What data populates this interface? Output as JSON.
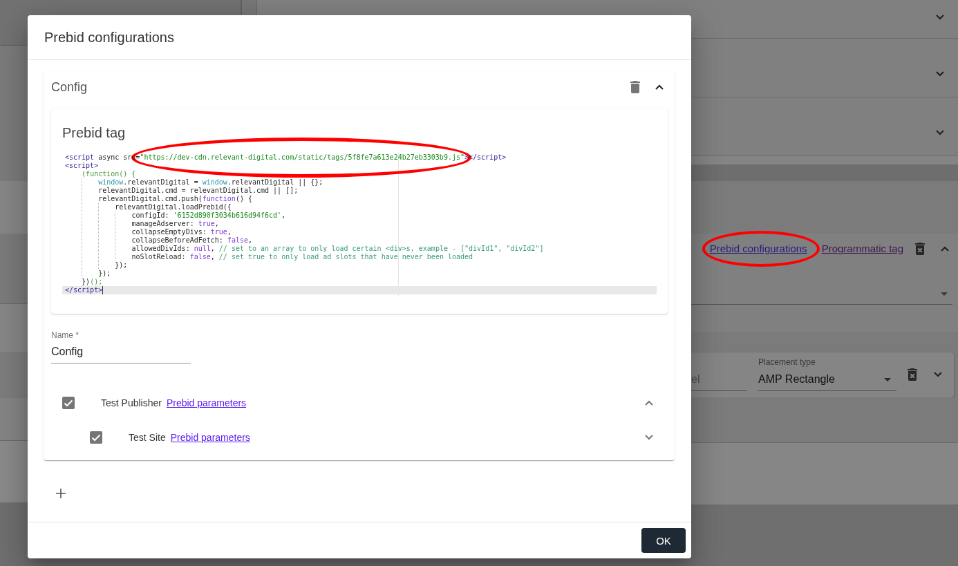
{
  "background": {
    "sections": [
      {
        "expanded": false
      },
      {
        "expanded": false
      },
      {
        "expanded": false
      }
    ],
    "ad_unit": {
      "links": [
        {
          "label": "Prebid configurations",
          "visited": false,
          "circled": true
        },
        {
          "label": "Programmatic tag",
          "visited": true,
          "circled": false
        }
      ],
      "expanded": true
    },
    "placement": {
      "name_field": {
        "placeholder": "el"
      },
      "type_field": {
        "label": "Placement type",
        "value": "AMP Rectangle"
      },
      "expanded": false
    }
  },
  "dialog": {
    "title": "Prebid configurations",
    "configs": [
      {
        "title": "Config",
        "expanded": true,
        "tag_card": {
          "title": "Prebid tag",
          "code_lines": [
            {
              "active": false,
              "segments": [
                {
                  "kind": "tag",
                  "text": "<script",
                  "circled": false
                },
                {
                  "kind": "plain",
                  "text": " async src=",
                  "circled": false
                },
                {
                  "kind": "string",
                  "text": "\"https://dev-cdn.relevant-digital.com/static/tags/5f8fe7a613e24b27eb3303b9.js\"",
                  "circled": true
                },
                {
                  "kind": "tag",
                  "text": "></script>",
                  "circled": false
                }
              ]
            },
            {
              "active": false,
              "segments": [
                {
                  "kind": "tag",
                  "text": "<script>",
                  "circled": false
                }
              ]
            },
            {
              "active": false,
              "segments": [
                {
                  "kind": "paren",
                  "text": "    (function() {",
                  "circled": false
                }
              ]
            },
            {
              "active": false,
              "segments": [
                {
                  "kind": "variable",
                  "text": "        window",
                  "circled": false
                },
                {
                  "kind": "plain",
                  "text": ".relevantDigital = ",
                  "circled": false
                },
                {
                  "kind": "variable",
                  "text": "window",
                  "circled": false
                },
                {
                  "kind": "plain",
                  "text": ".relevantDigital || {};",
                  "circled": false
                }
              ]
            },
            {
              "active": false,
              "segments": [
                {
                  "kind": "plain",
                  "text": "        relevantDigital.cmd = relevantDigital.cmd || [];",
                  "circled": false
                }
              ]
            },
            {
              "active": false,
              "segments": [
                {
                  "kind": "plain",
                  "text": "        relevantDigital.cmd.push(",
                  "circled": false
                },
                {
                  "kind": "keyword",
                  "text": "function",
                  "circled": false
                },
                {
                  "kind": "plain",
                  "text": "() {",
                  "circled": false
                }
              ]
            },
            {
              "active": false,
              "segments": [
                {
                  "kind": "plain",
                  "text": "            relevantDigital.loadPrebid({",
                  "circled": false
                }
              ]
            },
            {
              "active": false,
              "segments": [
                {
                  "kind": "plain",
                  "text": "                configId: ",
                  "circled": false
                },
                {
                  "kind": "string",
                  "text": "'6152d890f3034b616d94f6cd'",
                  "circled": false
                },
                {
                  "kind": "plain",
                  "text": ",",
                  "circled": false
                }
              ]
            },
            {
              "active": false,
              "segments": [
                {
                  "kind": "plain",
                  "text": "                manageAdserver: ",
                  "circled": false
                },
                {
                  "kind": "keyword",
                  "text": "true",
                  "circled": false
                },
                {
                  "kind": "plain",
                  "text": ",",
                  "circled": false
                }
              ]
            },
            {
              "active": false,
              "segments": [
                {
                  "kind": "plain",
                  "text": "                collapseEmptyDivs: ",
                  "circled": false
                },
                {
                  "kind": "keyword",
                  "text": "true",
                  "circled": false
                },
                {
                  "kind": "plain",
                  "text": ",",
                  "circled": false
                }
              ]
            },
            {
              "active": false,
              "segments": [
                {
                  "kind": "plain",
                  "text": "                collapseBeforeAdFetch: ",
                  "circled": false
                },
                {
                  "kind": "keyword",
                  "text": "false",
                  "circled": false
                },
                {
                  "kind": "plain",
                  "text": ",",
                  "circled": false
                }
              ]
            },
            {
              "active": false,
              "segments": [
                {
                  "kind": "plain",
                  "text": "                allowedDivIds: ",
                  "circled": false
                },
                {
                  "kind": "keyword",
                  "text": "null",
                  "circled": false
                },
                {
                  "kind": "plain",
                  "text": ", ",
                  "circled": false
                },
                {
                  "kind": "comment",
                  "text": "// set to an array to only load certain <div>s, example - [\"divId1\", \"divId2\"]",
                  "circled": false
                }
              ]
            },
            {
              "active": false,
              "segments": [
                {
                  "kind": "plain",
                  "text": "                noSlotReload: ",
                  "circled": false
                },
                {
                  "kind": "keyword",
                  "text": "false",
                  "circled": false
                },
                {
                  "kind": "plain",
                  "text": ", ",
                  "circled": false
                },
                {
                  "kind": "comment",
                  "text": "// set true to only load ad slots that have never been loaded",
                  "circled": false
                }
              ]
            },
            {
              "active": false,
              "segments": [
                {
                  "kind": "plain",
                  "text": "            });",
                  "circled": false
                }
              ]
            },
            {
              "active": false,
              "segments": [
                {
                  "kind": "plain",
                  "text": "        });",
                  "circled": false
                }
              ]
            },
            {
              "active": false,
              "segments": [
                {
                  "kind": "plain",
                  "text": "    })",
                  "circled": false
                },
                {
                  "kind": "paren",
                  "text": "();",
                  "circled": false
                }
              ]
            },
            {
              "active": true,
              "segments": [
                {
                  "kind": "tag",
                  "text": "</script>",
                  "circled": false
                }
              ]
            }
          ]
        },
        "name_field": {
          "label": "Name *",
          "value": "Config"
        },
        "tree": [
          {
            "label": "Test Publisher",
            "link": "Prebid parameters",
            "checked": true,
            "expanded": true,
            "children": [
              {
                "label": "Test Site",
                "link": "Prebid parameters",
                "checked": true,
                "expanded": false
              }
            ]
          }
        ]
      }
    ],
    "ok_button": "OK"
  }
}
